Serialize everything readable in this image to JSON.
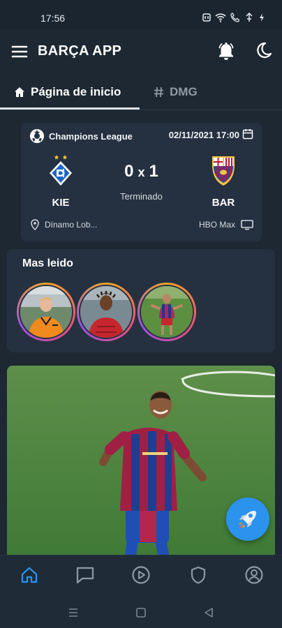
{
  "status_bar": {
    "time": "17:56"
  },
  "app_bar": {
    "title": "BARÇA APP"
  },
  "tabs": [
    {
      "label": "Página de inicio",
      "icon": "home-icon",
      "active": true
    },
    {
      "label": "DMG",
      "icon": "hash-icon",
      "active": false
    }
  ],
  "match": {
    "competition": "Champions League",
    "date": "02/11/2021 17:00",
    "home_team": "KIE",
    "away_team": "BAR",
    "home_score": "0",
    "separator": "x",
    "away_score": "1",
    "status": "Terminado",
    "venue": "Dínamo Lob...",
    "broadcaster": "HBO Max"
  },
  "most_read": {
    "title": "Mas leido",
    "stories": [
      {
        "name": "story-1"
      },
      {
        "name": "story-2"
      },
      {
        "name": "story-3"
      }
    ]
  },
  "bottom_nav": [
    {
      "icon": "home-icon",
      "active": true
    },
    {
      "icon": "chat-icon",
      "active": false
    },
    {
      "icon": "play-icon",
      "active": false
    },
    {
      "icon": "shield-icon",
      "active": false
    },
    {
      "icon": "profile-icon",
      "active": false
    }
  ],
  "colors": {
    "background": "#1d2833",
    "card": "#253140",
    "accent": "#2b93ee",
    "active_nav": "#2b93ee",
    "inactive_nav": "#8f9aa5"
  }
}
